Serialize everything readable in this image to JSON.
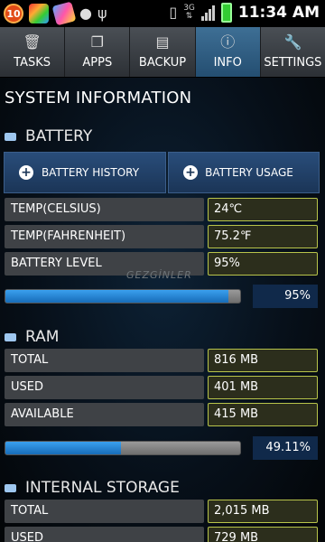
{
  "status_bar": {
    "notification_count": "10",
    "network_type": "3G",
    "time": "11:34 AM"
  },
  "tabs": [
    {
      "label": "TASKS",
      "icon": "trash-icon",
      "active": false
    },
    {
      "label": "APPS",
      "icon": "apps-icon",
      "active": false
    },
    {
      "label": "BACKUP",
      "icon": "floppy-icon",
      "active": false
    },
    {
      "label": "INFO",
      "icon": "info-icon",
      "active": true
    },
    {
      "label": "SETTINGS",
      "icon": "wrench-icon",
      "active": false
    }
  ],
  "page_title": "SYSTEM INFORMATION",
  "watermark": "GEZGİNLER",
  "battery": {
    "title": "BATTERY",
    "history_button": "BATTERY HISTORY",
    "usage_button": "BATTERY USAGE",
    "rows": [
      {
        "label": "TEMP(CELSIUS)",
        "value": "24℃"
      },
      {
        "label": "TEMP(FAHRENHEIT)",
        "value": "75.2℉"
      },
      {
        "label": "BATTERY LEVEL",
        "value": "95%"
      }
    ],
    "progress_percent": 95,
    "progress_label": "95%"
  },
  "ram": {
    "title": "RAM",
    "rows": [
      {
        "label": "TOTAL",
        "value": "816 MB"
      },
      {
        "label": "USED",
        "value": "401 MB"
      },
      {
        "label": "AVAILABLE",
        "value": "415 MB"
      }
    ],
    "progress_percent": 49.11,
    "progress_label": "49.11%"
  },
  "internal_storage": {
    "title": "INTERNAL STORAGE",
    "rows": [
      {
        "label": "TOTAL",
        "value": "2,015 MB"
      },
      {
        "label": "USED",
        "value": "729 MB"
      }
    ]
  },
  "colors": {
    "accent_blue": "#176cb8",
    "value_border": "#b8c44a",
    "active_tab": "#3e6f95"
  }
}
